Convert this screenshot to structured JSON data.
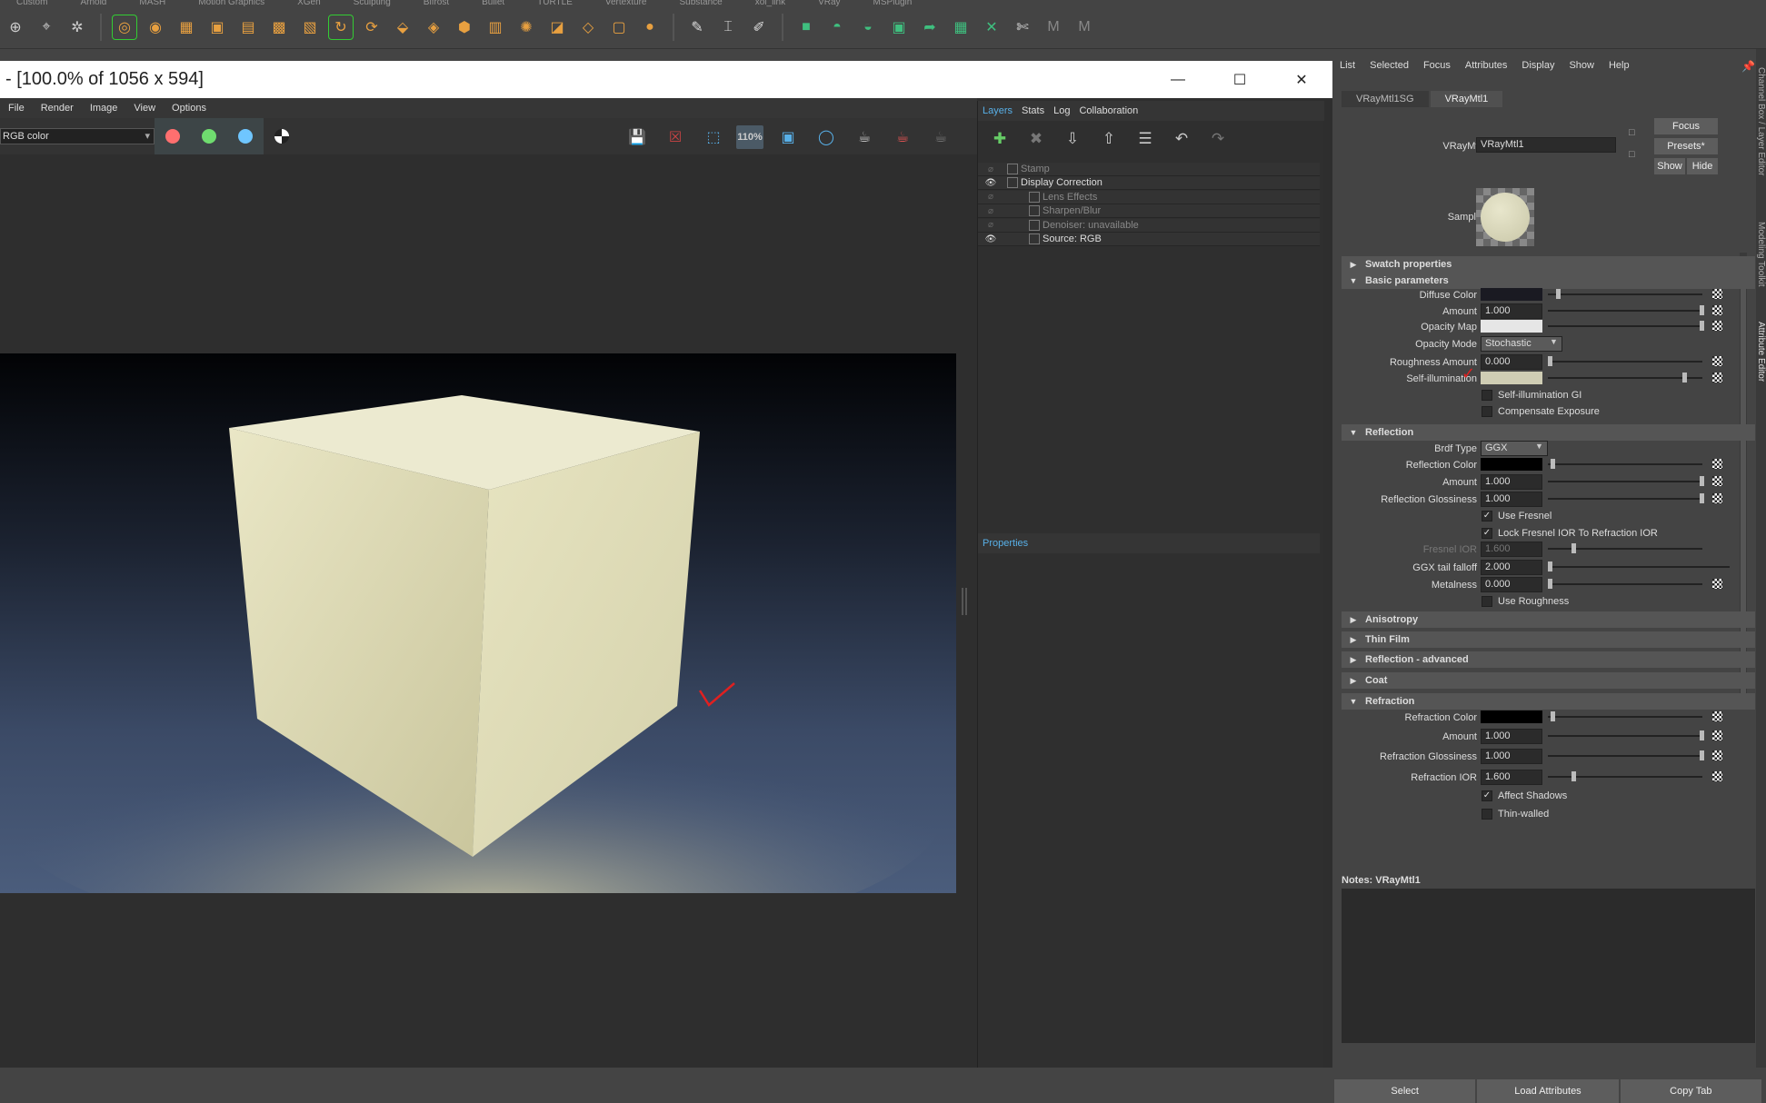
{
  "shelf": {
    "tabs": [
      "Custom",
      "Arnold",
      "MASH",
      "Motion Graphics",
      "XGen",
      "Sculpting",
      "Bifrost",
      "Bullet",
      "TURTLE",
      "Vertexture",
      "Substance",
      "xol_link",
      "VRay",
      "MSPlugin"
    ],
    "icons": [
      "locator-icon",
      "measure-icon",
      "origin-icon",
      "circle-tool-icon",
      "sphere-icon",
      "grid-icon",
      "cube-group-icon",
      "tiles-icon",
      "grid-pattern-icon",
      "box-icon",
      "rotate-icon",
      "loop-icon",
      "box-drop-icon",
      "plane-stack-icon",
      "cube-icon",
      "film-icon",
      "wheel-icon",
      "cube-cut-icon",
      "layer-icon",
      "frame-icon",
      "ball-icon",
      "pen-icon",
      "bracket-icon",
      "brush-icon",
      "green-box-icon",
      "green-cup-icon",
      "green-cup2-icon",
      "green-cubes-icon",
      "green-arrow-icon",
      "green-grid-icon",
      "green-cross-icon",
      "knife-icon",
      "m-icon",
      "m2-icon"
    ]
  },
  "vfb": {
    "title": "- [100.0% of 1056 x 594]",
    "menu": [
      "File",
      "Render",
      "Image",
      "View",
      "Options"
    ],
    "channel": "RGB color",
    "channel_colors": {
      "red": "#ff6f6f",
      "green": "#6fdc6f",
      "blue": "#6fc6ff"
    },
    "zoom_label": "110%"
  },
  "layers": {
    "tabs": [
      "Layers",
      "Stats",
      "Log",
      "Collaboration"
    ],
    "rows": [
      {
        "label": "Stamp",
        "visible": false,
        "indent": 0
      },
      {
        "label": "Display Correction",
        "visible": true,
        "indent": 0
      },
      {
        "label": "Lens Effects",
        "visible": false,
        "indent": 1
      },
      {
        "label": "Sharpen/Blur",
        "visible": false,
        "indent": 1
      },
      {
        "label": "Denoiser: unavailable",
        "visible": false,
        "indent": 1
      },
      {
        "label": "Source: RGB",
        "visible": true,
        "indent": 1
      }
    ],
    "properties_title": "Properties"
  },
  "ae": {
    "menu": [
      "List",
      "Selected",
      "Focus",
      "Attributes",
      "Display",
      "Show",
      "Help"
    ],
    "tabs": [
      "VRayMtl1SG",
      "VRayMtl1"
    ],
    "mtl_label": "VRayMtl:",
    "mtl_name": "VRayMtl1",
    "focus_btn": "Focus",
    "presets_btn": "Presets*",
    "show_btn": "Show",
    "hide_btn": "Hide",
    "sample_label": "Sample",
    "sections": {
      "swatch": "Swatch properties",
      "basic": "Basic parameters",
      "reflection": "Reflection",
      "anisotropy": "Anisotropy",
      "thinfilm": "Thin Film",
      "refl_adv": "Reflection - advanced",
      "coat": "Coat",
      "refraction": "Refraction"
    },
    "basic": {
      "diffuse_color": "Diffuse Color",
      "amount": "Amount",
      "amount_val": "1.000",
      "opacity_map": "Opacity Map",
      "opacity_mode": "Opacity Mode",
      "opacity_mode_val": "Stochastic",
      "roughness_amount": "Roughness Amount",
      "roughness_val": "0.000",
      "self_illum": "Self-illumination",
      "self_illum_gi": "Self-illumination GI",
      "compensate": "Compensate Exposure"
    },
    "reflection": {
      "brdf": "Brdf Type",
      "brdf_val": "GGX",
      "color": "Reflection Color",
      "amount": "Amount",
      "amount_val": "1.000",
      "gloss": "Reflection Glossiness",
      "gloss_val": "1.000",
      "use_fresnel": "Use Fresnel",
      "lock_fresnel": "Lock Fresnel IOR To Refraction IOR",
      "fresnel_ior": "Fresnel IOR",
      "fresnel_ior_val": "1.600",
      "ggx_tail": "GGX tail falloff",
      "ggx_tail_val": "2.000",
      "metalness": "Metalness",
      "metalness_val": "0.000",
      "use_roughness": "Use Roughness"
    },
    "refraction": {
      "color": "Refraction Color",
      "amount": "Amount",
      "amount_val": "1.000",
      "gloss": "Refraction Glossiness",
      "gloss_val": "1.000",
      "ior": "Refraction IOR",
      "ior_val": "1.600",
      "affect_shadows": "Affect Shadows",
      "thin_walled": "Thin-walled"
    },
    "notes_label": "Notes:  VRayMtl1",
    "bottom": [
      "Select",
      "Load Attributes",
      "Copy Tab"
    ],
    "side_labels": [
      "Channel Box / Layer Editor",
      "Modeling Toolkit",
      "Attribute Editor"
    ]
  }
}
